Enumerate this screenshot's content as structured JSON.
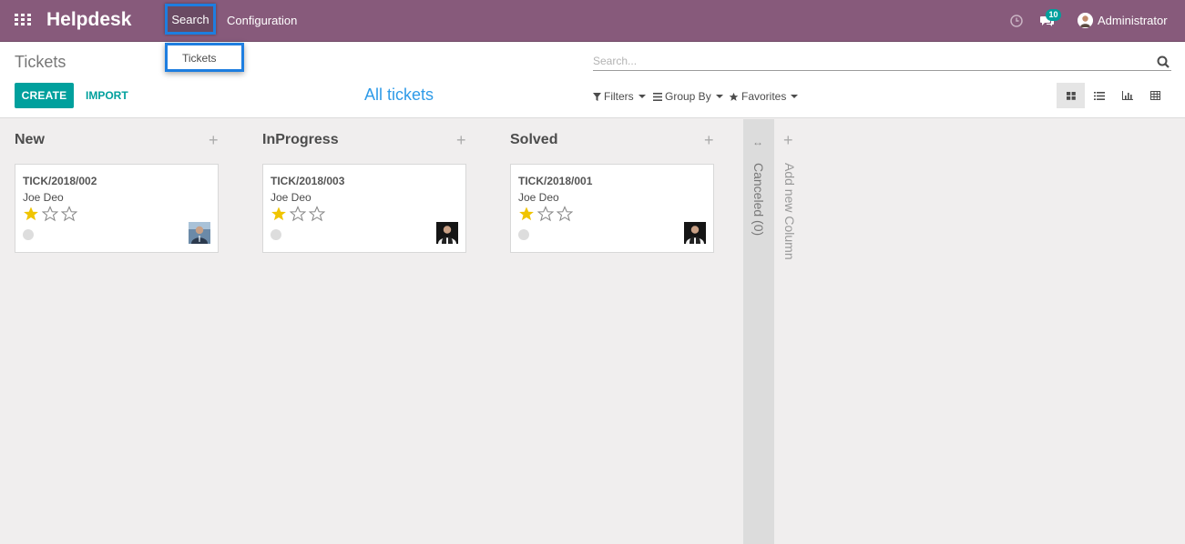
{
  "navbar": {
    "apps_icon": "apps-grid-icon",
    "brand": "Helpdesk",
    "menu_search": "Search",
    "menu_configuration": "Configuration",
    "activity_icon": "clock-icon",
    "messages_icon": "chat-icon",
    "messages_count": "10",
    "user_name": "Administrator"
  },
  "dropdown": {
    "items": [
      "Tickets"
    ]
  },
  "control_panel": {
    "breadcrumb": "Tickets",
    "search_placeholder": "Search...",
    "create_label": "CREATE",
    "import_label": "IMPORT",
    "view_title": "All tickets",
    "filters_label": "Filters",
    "groupby_label": "Group By",
    "favorites_label": "Favorites",
    "views": [
      "kanban",
      "list",
      "graph",
      "pivot"
    ],
    "active_view": "kanban"
  },
  "kanban": {
    "columns": [
      {
        "title": "New",
        "cards": [
          {
            "ref": "TICK/2018/002",
            "customer": "Joe Deo",
            "stars": 1,
            "max_stars": 3
          }
        ]
      },
      {
        "title": "InProgress",
        "cards": [
          {
            "ref": "TICK/2018/003",
            "customer": "Joe Deo",
            "stars": 1,
            "max_stars": 3
          }
        ]
      },
      {
        "title": "Solved",
        "cards": [
          {
            "ref": "TICK/2018/001",
            "customer": "Joe Deo",
            "stars": 1,
            "max_stars": 3
          }
        ]
      }
    ],
    "folded_column": "Canceled (0)",
    "add_column_label": "Add new Column"
  },
  "colors": {
    "navbar": "#875a7b",
    "primary": "#00a09d",
    "link_blue": "#2f9be8",
    "star": "#f0c400",
    "highlight": "#1e7ee0"
  }
}
